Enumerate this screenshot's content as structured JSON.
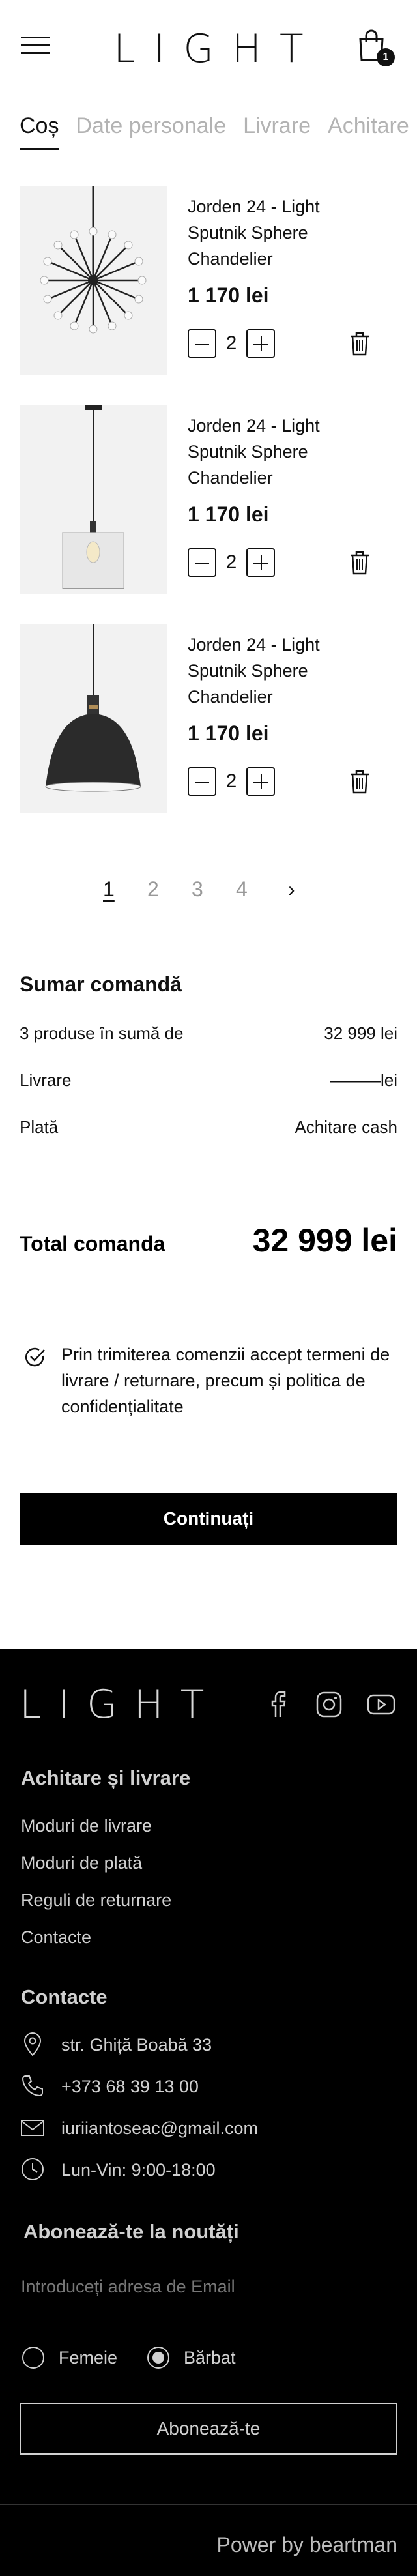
{
  "header": {
    "logo": "LIGHT",
    "cart_count": "1"
  },
  "tabs": [
    {
      "label": "Coș",
      "active": true
    },
    {
      "label": "Date personale",
      "active": false
    },
    {
      "label": "Livrare",
      "active": false
    },
    {
      "label": "Achitare",
      "active": false
    }
  ],
  "cart": {
    "items": [
      {
        "title": "Jorden 24 - Light Sputnik Sphere Chandelier",
        "price": "1 170 lei",
        "quantity": "2",
        "image": "sputnik-chandelier"
      },
      {
        "title": "Jorden 24 - Light Sputnik Sphere Chandelier",
        "price": "1 170 lei",
        "quantity": "2",
        "image": "glass-pendant"
      },
      {
        "title": "Jorden 24 - Light Sputnik Sphere Chandelier",
        "price": "1 170 lei",
        "quantity": "2",
        "image": "dome-pendant"
      }
    ]
  },
  "pagination": {
    "pages": [
      "1",
      "2",
      "3",
      "4"
    ],
    "current": "1",
    "next": "›"
  },
  "summary": {
    "title": "Sumar comandă",
    "products_label": "3 produse în sumă de",
    "products_value": "32 999 lei",
    "delivery_label": "Livrare",
    "delivery_value": "———lei",
    "payment_label": "Plată",
    "payment_value": "Achitare cash",
    "total_label": "Total comanda",
    "total_value": "32 999 lei"
  },
  "terms": {
    "text": "Prin trimiterea comenzii accept termeni de livrare / returnare, precum și politica de confidențialitate",
    "checked": true
  },
  "continue_label": "Continuați",
  "footer": {
    "logo": "LIGHT",
    "social": [
      "facebook-icon",
      "instagram-icon",
      "youtube-icon"
    ],
    "payment_heading": "Achitare și livrare",
    "links": [
      "Moduri de livrare",
      "Moduri de plată",
      "Reguli de returnare",
      "Contacte"
    ],
    "contacts_heading": "Contacte",
    "address": "str. Ghiță Boabă 33",
    "phone": "+373 68 39 13 00",
    "email": "iuriiantoseac@gmail.com",
    "hours": "Lun-Vin: 9:00-18:00",
    "newsletter_heading": "Abonează-te la noutăți",
    "email_placeholder": "Introduceți adresa de Email",
    "gender_options": [
      {
        "label": "Femeie",
        "selected": false
      },
      {
        "label": "Bărbat",
        "selected": true
      }
    ],
    "subscribe_label": "Abonează-te",
    "powered": "Power by beartman"
  },
  "colors": {
    "text": "#111111",
    "muted": "#b3b3b3",
    "footer_bg": "#000000",
    "footer_text": "#d0d0d0"
  }
}
